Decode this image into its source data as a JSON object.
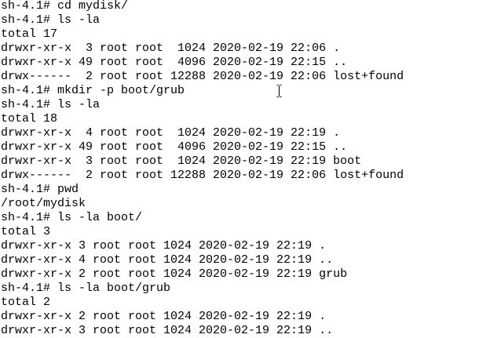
{
  "terminal": {
    "lines": [
      "sh-4.1# cd mydisk/",
      "sh-4.1# ls -la",
      "total 17",
      "drwxr-xr-x  3 root root  1024 2020-02-19 22:06 .",
      "drwxr-xr-x 49 root root  4096 2020-02-19 22:15 ..",
      "drwx------  2 root root 12288 2020-02-19 22:06 lost+found",
      "sh-4.1# mkdir -p boot/grub",
      "sh-4.1# ls -la",
      "total 18",
      "drwxr-xr-x  4 root root  1024 2020-02-19 22:19 .",
      "drwxr-xr-x 49 root root  4096 2020-02-19 22:15 ..",
      "drwxr-xr-x  3 root root  1024 2020-02-19 22:19 boot",
      "drwx------  2 root root 12288 2020-02-19 22:06 lost+found",
      "sh-4.1# pwd",
      "/root/mydisk",
      "sh-4.1# ls -la boot/",
      "total 3",
      "drwxr-xr-x 3 root root 1024 2020-02-19 22:19 .",
      "drwxr-xr-x 4 root root 1024 2020-02-19 22:19 ..",
      "drwxr-xr-x 2 root root 1024 2020-02-19 22:19 grub",
      "sh-4.1# ls -la boot/grub",
      "total 2",
      "drwxr-xr-x 2 root root 1024 2020-02-19 22:19 .",
      "drwxr-xr-x 3 root root 1024 2020-02-19 22:19 .."
    ],
    "mouse_cursor_icon": "ibeam-cursor-icon",
    "colors": {
      "background": "#ffffff",
      "foreground": "#000000"
    }
  }
}
